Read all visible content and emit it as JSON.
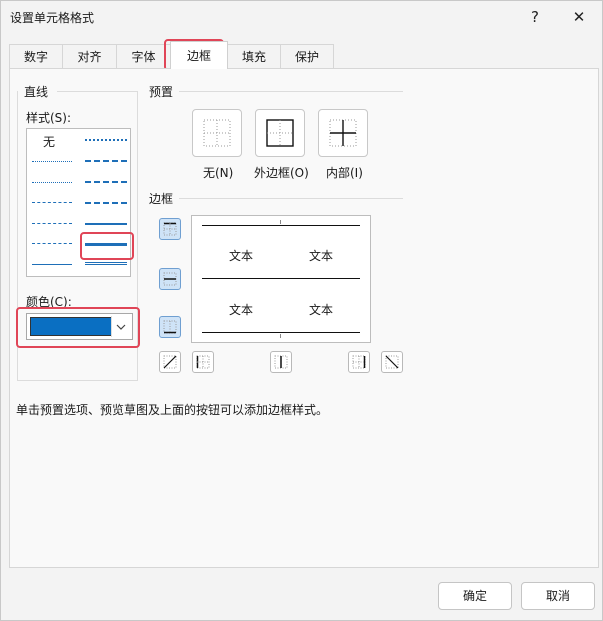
{
  "window": {
    "title": "设置单元格格式",
    "help": "?",
    "close": "✕"
  },
  "tabs": [
    {
      "label": "数字"
    },
    {
      "label": "对齐"
    },
    {
      "label": "字体"
    },
    {
      "label": "边框",
      "active": true
    },
    {
      "label": "填充"
    },
    {
      "label": "保护"
    }
  ],
  "line": {
    "group_title": "直线",
    "style_label": "样式(S):",
    "none_label": "无",
    "color_label": "颜色(C):",
    "selected_color": "#0a6fc2"
  },
  "presets": {
    "group_title": "预置",
    "items": [
      {
        "label": "无(N)"
      },
      {
        "label": "外边框(O)"
      },
      {
        "label": "内部(I)"
      }
    ]
  },
  "border": {
    "group_title": "边框",
    "preview_text": [
      "文本",
      "文本",
      "文本",
      "文本"
    ]
  },
  "hint": "单击预置选项、预览草图及上面的按钮可以添加边框样式。",
  "footer": {
    "ok": "确定",
    "cancel": "取消"
  }
}
